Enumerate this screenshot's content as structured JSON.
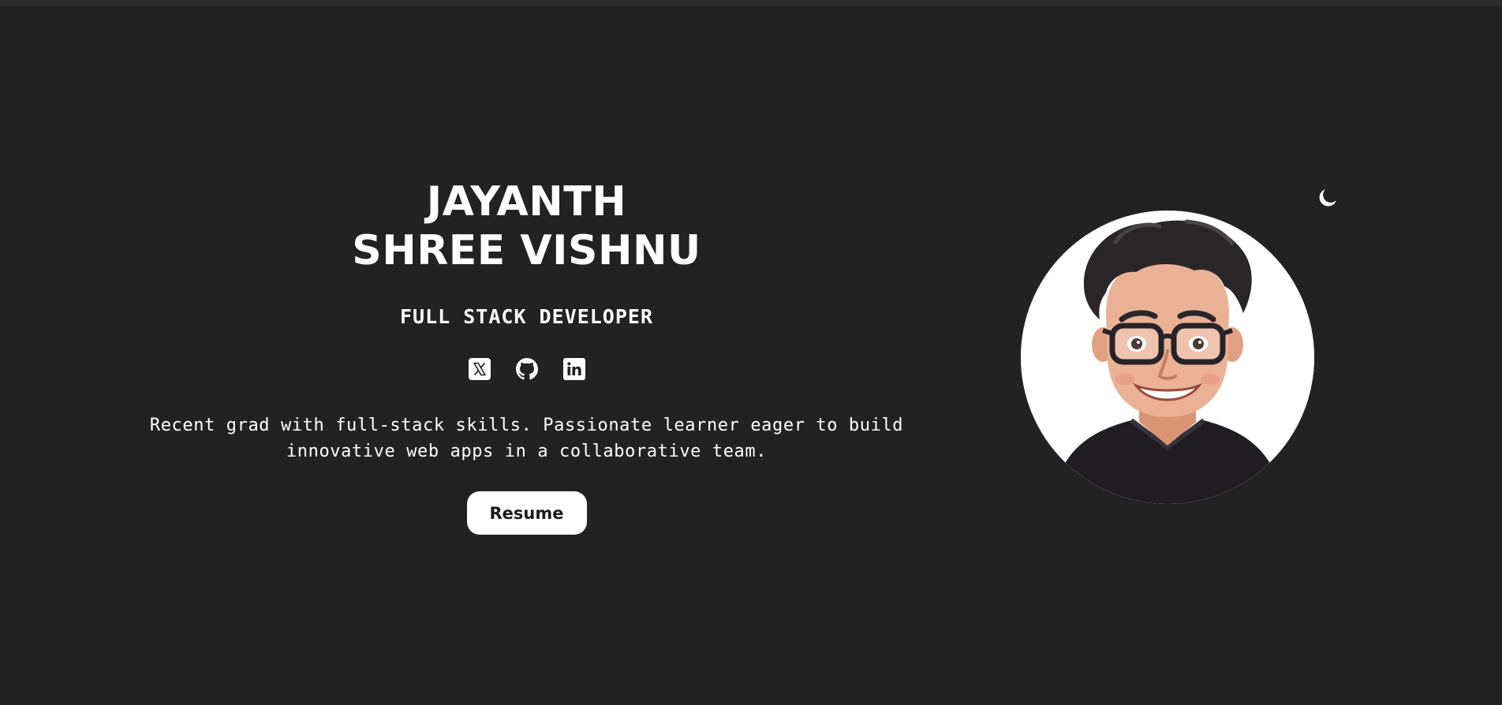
{
  "hero": {
    "name_line1": "JAYANTH",
    "name_line2": "SHREE VISHNU",
    "role": "FULL STACK DEVELOPER",
    "bio": "Recent grad with full-stack skills. Passionate learner eager to build innovative web apps in a collaborative team.",
    "resume_label": "Resume"
  },
  "socials": [
    {
      "name": "X (Twitter)",
      "icon": "x-twitter-icon"
    },
    {
      "name": "GitHub",
      "icon": "github-icon"
    },
    {
      "name": "LinkedIn",
      "icon": "linkedin-icon"
    }
  ],
  "avatar": {
    "icon": "avatar-cartoon"
  },
  "theme_toggle": {
    "icon": "moon-icon"
  },
  "colors": {
    "background": "#222222",
    "text": "#ffffff",
    "button_bg": "#ffffff",
    "button_text": "#1a1a1a"
  }
}
